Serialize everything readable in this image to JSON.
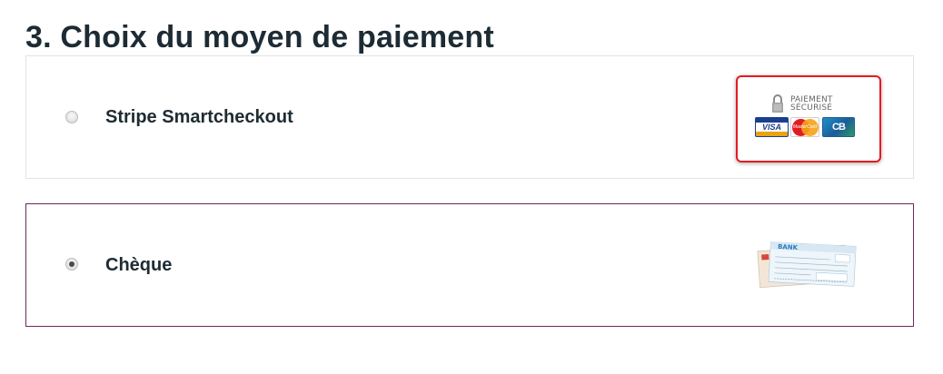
{
  "section": {
    "title": "3. Choix du moyen de paiement"
  },
  "payment_options": [
    {
      "label": "Stripe Smartcheckout",
      "selected": false,
      "badge": {
        "lines": [
          "PAIEMENT",
          "SÉCURISÉ"
        ],
        "cards": [
          "VISA",
          "MasterCard",
          "CB"
        ]
      }
    },
    {
      "label": "Chèque",
      "selected": true,
      "image": {
        "bank_text": "BANK"
      }
    }
  ],
  "colors": {
    "selected_border": "#6b2a5f",
    "default_border": "#e3e3e3",
    "badge_border": "#e31b23",
    "title_text": "#1d2b34"
  }
}
